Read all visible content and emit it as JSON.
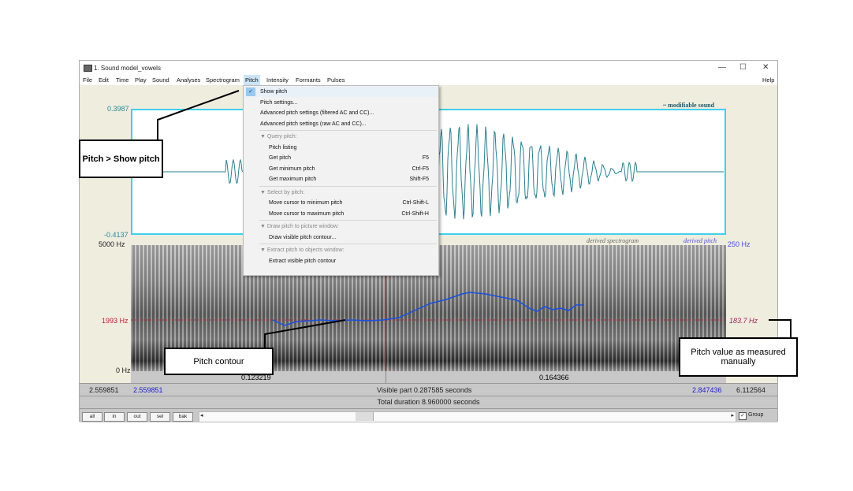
{
  "window": {
    "title": "1. Sound model_vowels",
    "controls": [
      "—",
      "☐",
      "✕"
    ]
  },
  "menubar": [
    "File",
    "Edit",
    "Time",
    "Play",
    "Sound",
    "Analyses",
    "Spectrogram",
    "Pitch",
    "Intensity",
    "Formants",
    "Pulses"
  ],
  "help": "Help",
  "pitch_menu": {
    "items": [
      {
        "label": "Show pitch",
        "checked": true
      },
      {
        "label": "Pitch settings..."
      },
      {
        "label": "Advanced pitch settings (filtered AC and CC)..."
      },
      {
        "label": "Advanced pitch settings (raw AC and CC)..."
      },
      {
        "label": "▼ Query pitch:",
        "header": true
      },
      {
        "label": "Pitch listing",
        "sub": true
      },
      {
        "label": "Get pitch",
        "shortcut": "F5",
        "sub": true
      },
      {
        "label": "Get minimum pitch",
        "shortcut": "Ctrl-F5",
        "sub": true
      },
      {
        "label": "Get maximum pitch",
        "shortcut": "Shift-F5",
        "sub": true
      },
      {
        "label": "▼ Select by pitch:",
        "header": true
      },
      {
        "label": "Move cursor to minimum pitch",
        "shortcut": "Ctrl-Shift-L",
        "sub": true
      },
      {
        "label": "Move cursor to maximum pitch",
        "shortcut": "Ctrl-Shift-H",
        "sub": true
      },
      {
        "label": "▼ Draw pitch to picture window:",
        "header": true
      },
      {
        "label": "Draw visible pitch contour...",
        "sub": true
      },
      {
        "label": "▼ Extract pitch to objects window:",
        "header": true
      },
      {
        "label": "Extract visible pitch contour",
        "sub": true
      }
    ]
  },
  "waveform": {
    "ymax": "0.3987",
    "ymin": "-0.4137",
    "label": "~ modifiable sound"
  },
  "spectrogram": {
    "fmax": "5000 Hz",
    "fmin": "0 Hz",
    "cursor_freq": "1993 Hz",
    "pitch_max": "250 Hz",
    "pitch_value": "183.7 Hz",
    "legend_spec": "derived spectrogram",
    "legend_pitch": "derived pitch"
  },
  "time_axis": {
    "left": "0.123219",
    "right": "0.164366"
  },
  "status": {
    "start_total": "2.559851",
    "start_visible": "2.559851",
    "visible": "Visible part 0.287585 seconds",
    "end_visible": "2.847436",
    "end_total": "6.112564",
    "total": "Total duration 8.960000 seconds"
  },
  "buttons": [
    "all",
    "in",
    "out",
    "sel",
    "bak"
  ],
  "group": {
    "label": "Group",
    "checked": true
  },
  "annotations": {
    "show_pitch": "Pitch > Show pitch",
    "contour": "Pitch contour",
    "manual": "Pitch value as measured manually"
  },
  "colors": {
    "waveform": "#2a7f8f",
    "pitch": "#1a4fe0",
    "cursor": "#c0203a",
    "accent": "#3fd0ee"
  }
}
